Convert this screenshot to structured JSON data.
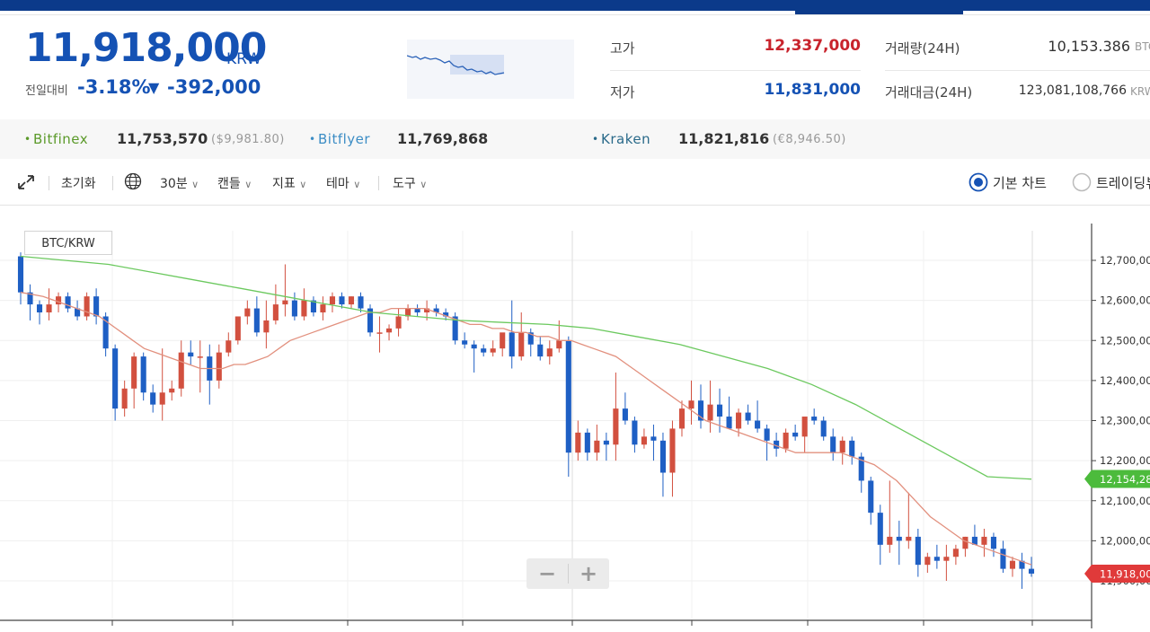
{
  "header": {
    "price": "11,918,000",
    "unit": "KRW",
    "change_label": "전일대비",
    "change_pct": "-3.18%",
    "change_arrow": "▼",
    "change_abs": "-392,000",
    "color_down": "#1552b4",
    "color_up": "#d2202a"
  },
  "stats": {
    "high_label": "고가",
    "high_value": "12,337,000",
    "low_label": "저가",
    "low_value": "11,831,000",
    "volume_label": "거래량(24H)",
    "volume_value": "10,153.386",
    "volume_unit": "BTC",
    "amount_label": "거래대금(24H)",
    "amount_value": "123,081,108,766",
    "amount_unit": "KRW"
  },
  "exchanges": [
    {
      "name": "Bitfinex",
      "value": "11,753,570",
      "sub": "($9,981.80)",
      "color": "#5b9a2a"
    },
    {
      "name": "Bitflyer",
      "value": "11,769,868",
      "sub": "",
      "color": "#3c8dc5"
    },
    {
      "name": "Kraken",
      "value": "11,821,816",
      "sub": "(€8,946.50)",
      "color": "#2a6a8a"
    }
  ],
  "toolbar": {
    "reset": "초기화",
    "interval": "30분",
    "candles": "캔들",
    "indicators": "지표",
    "theme": "테마",
    "tools": "도구",
    "basic_chart": "기본 차트",
    "trading_view": "트레이딩뷰"
  },
  "chart_data": {
    "type": "candlestick",
    "pair": "BTC/KRW",
    "y_ticks": [
      "12,700,000",
      "12,600,000",
      "12,500,000",
      "12,400,000",
      "12,300,000",
      "12,200,000",
      "12,100,000",
      "12,000,000",
      "11,900,000"
    ],
    "y_tick_values": [
      12700000,
      12600000,
      12500000,
      12400000,
      12300000,
      12200000,
      12100000,
      12000000,
      11900000
    ],
    "ylim": [
      11830000,
      12745000
    ],
    "ma_long_tag": "12,154,28",
    "last_price_tag": "11,918,00",
    "candles": [
      [
        12710000,
        12720000,
        12590000,
        12620000
      ],
      [
        12620000,
        12640000,
        12550000,
        12590000
      ],
      [
        12590000,
        12600000,
        12540000,
        12570000
      ],
      [
        12570000,
        12630000,
        12550000,
        12590000
      ],
      [
        12590000,
        12620000,
        12570000,
        12610000
      ],
      [
        12610000,
        12620000,
        12570000,
        12580000
      ],
      [
        12580000,
        12600000,
        12550000,
        12560000
      ],
      [
        12560000,
        12620000,
        12550000,
        12610000
      ],
      [
        12610000,
        12630000,
        12540000,
        12560000
      ],
      [
        12560000,
        12570000,
        12460000,
        12480000
      ],
      [
        12480000,
        12490000,
        12300000,
        12330000
      ],
      [
        12330000,
        12400000,
        12310000,
        12380000
      ],
      [
        12380000,
        12470000,
        12330000,
        12460000
      ],
      [
        12460000,
        12470000,
        12350000,
        12370000
      ],
      [
        12370000,
        12390000,
        12320000,
        12340000
      ],
      [
        12340000,
        12480000,
        12300000,
        12370000
      ],
      [
        12370000,
        12400000,
        12350000,
        12380000
      ],
      [
        12380000,
        12500000,
        12360000,
        12470000
      ],
      [
        12470000,
        12500000,
        12440000,
        12460000
      ],
      [
        12460000,
        12500000,
        12370000,
        12460000
      ],
      [
        12460000,
        12490000,
        12340000,
        12400000
      ],
      [
        12400000,
        12490000,
        12380000,
        12470000
      ],
      [
        12470000,
        12520000,
        12460000,
        12500000
      ],
      [
        12500000,
        12560000,
        12490000,
        12560000
      ],
      [
        12560000,
        12600000,
        12540000,
        12580000
      ],
      [
        12580000,
        12610000,
        12510000,
        12520000
      ],
      [
        12520000,
        12600000,
        12480000,
        12550000
      ],
      [
        12550000,
        12640000,
        12540000,
        12590000
      ],
      [
        12590000,
        12690000,
        12560000,
        12600000
      ],
      [
        12600000,
        12620000,
        12550000,
        12560000
      ],
      [
        12560000,
        12630000,
        12550000,
        12600000
      ],
      [
        12600000,
        12610000,
        12560000,
        12570000
      ],
      [
        12570000,
        12610000,
        12550000,
        12590000
      ],
      [
        12590000,
        12620000,
        12570000,
        12610000
      ],
      [
        12610000,
        12620000,
        12580000,
        12590000
      ],
      [
        12590000,
        12610000,
        12580000,
        12610000
      ],
      [
        12610000,
        12620000,
        12570000,
        12580000
      ],
      [
        12580000,
        12590000,
        12510000,
        12520000
      ],
      [
        12520000,
        12560000,
        12470000,
        12520000
      ],
      [
        12520000,
        12540000,
        12500000,
        12530000
      ],
      [
        12530000,
        12580000,
        12510000,
        12560000
      ],
      [
        12560000,
        12590000,
        12550000,
        12580000
      ],
      [
        12580000,
        12590000,
        12560000,
        12570000
      ],
      [
        12570000,
        12600000,
        12550000,
        12580000
      ],
      [
        12580000,
        12590000,
        12560000,
        12570000
      ],
      [
        12570000,
        12580000,
        12550000,
        12560000
      ],
      [
        12560000,
        12570000,
        12490000,
        12500000
      ],
      [
        12500000,
        12520000,
        12480000,
        12490000
      ],
      [
        12490000,
        12500000,
        12420000,
        12480000
      ],
      [
        12480000,
        12490000,
        12460000,
        12470000
      ],
      [
        12470000,
        12500000,
        12460000,
        12480000
      ],
      [
        12480000,
        12510000,
        12460000,
        12520000
      ],
      [
        12520000,
        12600000,
        12430000,
        12460000
      ],
      [
        12460000,
        12570000,
        12450000,
        12520000
      ],
      [
        12520000,
        12530000,
        12460000,
        12490000
      ],
      [
        12490000,
        12510000,
        12450000,
        12460000
      ],
      [
        12460000,
        12500000,
        12440000,
        12480000
      ],
      [
        12480000,
        12550000,
        12470000,
        12500000
      ],
      [
        12500000,
        12510000,
        12160000,
        12220000
      ],
      [
        12220000,
        12300000,
        12200000,
        12270000
      ],
      [
        12270000,
        12280000,
        12200000,
        12220000
      ],
      [
        12220000,
        12290000,
        12200000,
        12250000
      ],
      [
        12250000,
        12270000,
        12200000,
        12240000
      ],
      [
        12240000,
        12420000,
        12200000,
        12330000
      ],
      [
        12330000,
        12370000,
        12290000,
        12300000
      ],
      [
        12300000,
        12310000,
        12220000,
        12240000
      ],
      [
        12240000,
        12280000,
        12230000,
        12260000
      ],
      [
        12260000,
        12290000,
        12200000,
        12250000
      ],
      [
        12250000,
        12270000,
        12110000,
        12170000
      ],
      [
        12170000,
        12300000,
        12110000,
        12280000
      ],
      [
        12280000,
        12350000,
        12260000,
        12330000
      ],
      [
        12330000,
        12400000,
        12290000,
        12350000
      ],
      [
        12350000,
        12390000,
        12280000,
        12300000
      ],
      [
        12300000,
        12400000,
        12270000,
        12340000
      ],
      [
        12340000,
        12380000,
        12270000,
        12310000
      ],
      [
        12310000,
        12360000,
        12290000,
        12280000
      ],
      [
        12280000,
        12330000,
        12260000,
        12320000
      ],
      [
        12320000,
        12340000,
        12290000,
        12300000
      ],
      [
        12300000,
        12350000,
        12270000,
        12280000
      ],
      [
        12280000,
        12290000,
        12200000,
        12250000
      ],
      [
        12250000,
        12270000,
        12210000,
        12230000
      ],
      [
        12230000,
        12280000,
        12220000,
        12270000
      ],
      [
        12270000,
        12290000,
        12250000,
        12260000
      ],
      [
        12260000,
        12300000,
        12220000,
        12310000
      ],
      [
        12310000,
        12330000,
        12290000,
        12300000
      ],
      [
        12300000,
        12310000,
        12250000,
        12260000
      ],
      [
        12260000,
        12280000,
        12200000,
        12220000
      ],
      [
        12220000,
        12260000,
        12190000,
        12250000
      ],
      [
        12250000,
        12260000,
        12190000,
        12210000
      ],
      [
        12210000,
        12220000,
        12120000,
        12150000
      ],
      [
        12150000,
        12160000,
        12040000,
        12070000
      ],
      [
        12070000,
        12090000,
        11940000,
        11990000
      ],
      [
        11990000,
        12150000,
        11970000,
        12010000
      ],
      [
        12010000,
        12050000,
        11940000,
        12000000
      ],
      [
        12000000,
        12120000,
        11980000,
        12010000
      ],
      [
        12010000,
        12030000,
        11910000,
        11940000
      ],
      [
        11940000,
        11970000,
        11920000,
        11960000
      ],
      [
        11960000,
        11990000,
        11930000,
        11950000
      ],
      [
        11950000,
        11990000,
        11900000,
        11960000
      ],
      [
        11960000,
        11990000,
        11940000,
        11980000
      ],
      [
        11980000,
        12010000,
        11960000,
        12010000
      ],
      [
        12010000,
        12040000,
        11990000,
        11990000
      ],
      [
        11990000,
        12030000,
        11960000,
        12010000
      ],
      [
        12010000,
        12020000,
        11960000,
        11980000
      ],
      [
        11980000,
        12000000,
        11920000,
        11930000
      ],
      [
        11930000,
        11960000,
        11910000,
        11950000
      ],
      [
        11950000,
        11970000,
        11880000,
        11930000
      ],
      [
        11930000,
        11960000,
        11910000,
        11918000
      ]
    ],
    "ma_short": [
      12620000,
      12615000,
      12610000,
      12600000,
      12590000,
      12580000,
      12570000,
      12560000,
      12540000,
      12520000,
      12500000,
      12480000,
      12470000,
      12460000,
      12450000,
      12440000,
      12430000,
      12430000,
      12430000,
      12440000,
      12440000,
      12450000,
      12460000,
      12480000,
      12500000,
      12510000,
      12520000,
      12530000,
      12540000,
      12550000,
      12560000,
      12570000,
      12570000,
      12580000,
      12580000,
      12580000,
      12580000,
      12570000,
      12560000,
      12550000,
      12540000,
      12540000,
      12530000,
      12530000,
      12520000,
      12520000,
      12510000,
      12510000,
      12500000,
      12500000,
      12490000,
      12480000,
      12470000,
      12460000,
      12440000,
      12420000,
      12400000,
      12380000,
      12360000,
      12340000,
      12320000,
      12300000,
      12290000,
      12280000,
      12270000,
      12260000,
      12250000,
      12240000,
      12230000,
      12220000,
      12220000,
      12220000,
      12220000,
      12220000,
      12210000,
      12200000,
      12190000,
      12170000,
      12150000,
      12120000,
      12090000,
      12060000,
      12040000,
      12020000,
      12000000,
      11990000,
      11980000,
      11970000,
      11960000,
      11950000,
      11940000
    ],
    "ma_long": [
      12710000,
      12700000,
      12690000,
      12670000,
      12650000,
      12630000,
      12610000,
      12590000,
      12570000,
      12560000,
      12550000,
      12545000,
      12540000,
      12530000,
      12510000,
      12490000,
      12460000,
      12430000,
      12390000,
      12340000,
      12280000,
      12220000,
      12160000,
      12154000
    ]
  }
}
